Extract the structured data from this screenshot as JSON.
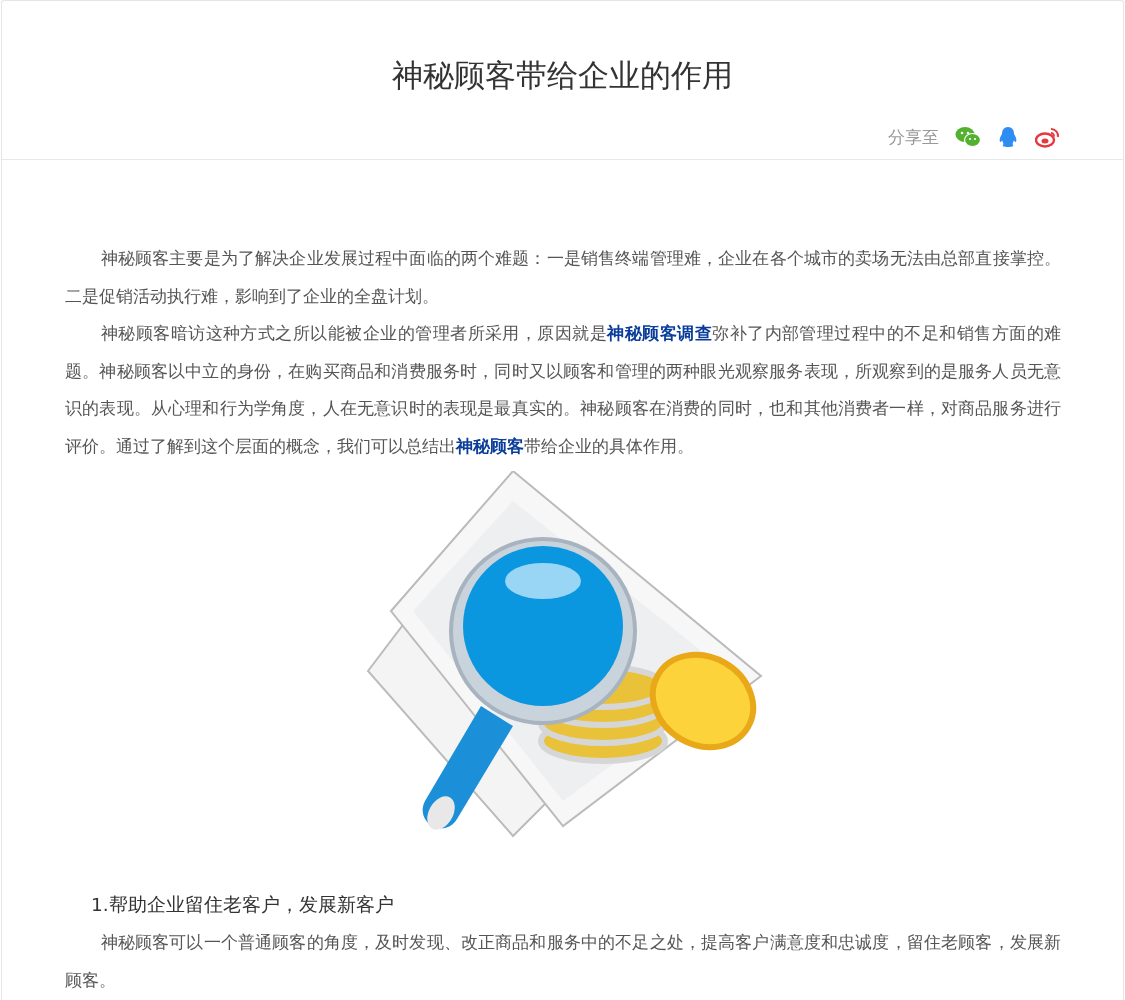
{
  "title": "神秘顾客带给企业的作用",
  "share": {
    "label": "分享至",
    "targets": [
      {
        "kind": "wechat"
      },
      {
        "kind": "qq"
      },
      {
        "kind": "weibo"
      }
    ]
  },
  "paragraphs": [
    {
      "kind": "body",
      "segments": [
        {
          "kind": "text",
          "text": "神秘顾客主要是为了解决企业发展过程中面临的两个难题：一是销售终端管理难，企业在各个城市的卖场无法由总部直接掌控。二是促销活动执行难，影响到了企业的全盘计划。"
        }
      ]
    },
    {
      "kind": "body",
      "segments": [
        {
          "kind": "text",
          "text": "神秘顾客暗访这种方式之所以能被企业的管理者所采用，原因就是"
        },
        {
          "kind": "link",
          "text": "神秘顾客调查"
        },
        {
          "kind": "text",
          "text": "弥补了内部管理过程中的不足和销售方面的难题。神秘顾客以中立的身份，在购买商品和消费服务时，同时又以顾客和管理的两种眼光观察服务表现，所观察到的是服务人员无意识的表现。从心理和行为学角度，人在无意识时的表现是最真实的。神秘顾客在消费的同时，也和其他消费者一样，对商品服务进行评价。通过了解到这个层面的概念，我们可以总结出"
        },
        {
          "kind": "link",
          "text": "神秘顾客"
        },
        {
          "kind": "text",
          "text": "带给企业的具体作用。"
        }
      ]
    },
    {
      "kind": "image"
    },
    {
      "kind": "heading",
      "segments": [
        {
          "kind": "text",
          "text": "1.帮助企业留住老客户，发展新客户"
        }
      ]
    },
    {
      "kind": "body",
      "segments": [
        {
          "kind": "text",
          "text": "神秘顾客可以一个普通顾客的角度，及时发现、改正商品和服务中的不足之处，提高客户满意度和忠诚度，留住老顾客，发展新顾客。"
        }
      ]
    }
  ]
}
